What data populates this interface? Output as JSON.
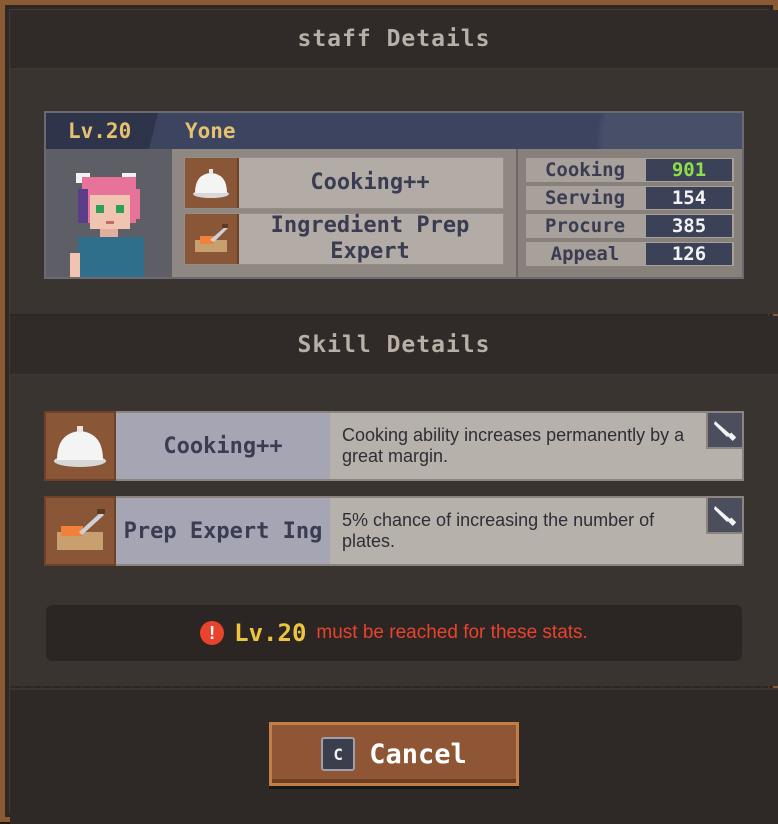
{
  "dialog": {
    "title": "staff Details",
    "section_title": "Skill Details"
  },
  "staff": {
    "level": "Lv.20",
    "name": "Yone",
    "skills": [
      {
        "name": "Cooking++",
        "icon": "cloche-icon"
      },
      {
        "name": "Ingredient Prep Expert",
        "icon": "cutting-board-icon"
      }
    ],
    "stats": [
      {
        "label": "Cooking",
        "value": "901",
        "highlight": true
      },
      {
        "label": "Serving",
        "value": "154",
        "highlight": false
      },
      {
        "label": "Procure",
        "value": "385",
        "highlight": false
      },
      {
        "label": "Appeal",
        "value": "126",
        "highlight": false
      }
    ]
  },
  "skill_details": [
    {
      "name": "Cooking++",
      "description": "Cooking ability increases permanently by a great margin.",
      "icon": "cloche-icon"
    },
    {
      "name": "Prep Expert   Ing",
      "description": "5% chance of increasing the number of plates.",
      "icon": "cutting-board-icon"
    }
  ],
  "warning": {
    "icon": "!",
    "level": "Lv.20",
    "text": "must be reached for these stats."
  },
  "footer": {
    "key": "C",
    "cancel_label": "Cancel"
  },
  "colors": {
    "accent_gold": "#e6c170",
    "warning_red": "#e8432c",
    "stat_highlight": "#8ee04a",
    "button_brown": "#8e5634"
  }
}
